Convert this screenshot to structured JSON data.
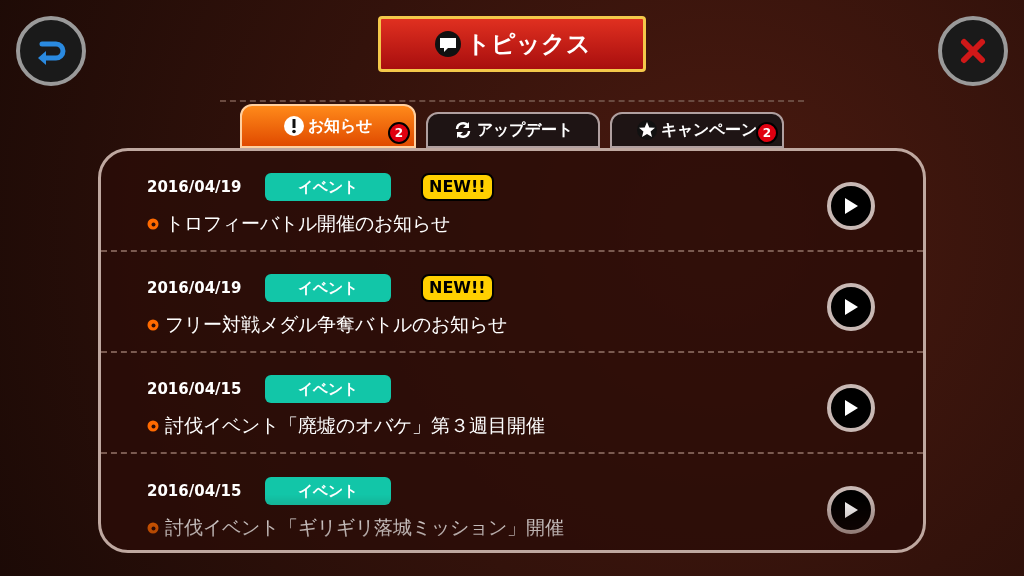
{
  "header": {
    "title": "トピックス"
  },
  "tabs": [
    {
      "label": "お知らせ",
      "kind": "notice",
      "selected": true,
      "badge": "2"
    },
    {
      "label": "アップデート",
      "kind": "update",
      "selected": false
    },
    {
      "label": "キャンペーン",
      "kind": "campaign",
      "selected": false,
      "badge": "2"
    }
  ],
  "topics": [
    {
      "date": "2016/04/19",
      "tag": "イベント",
      "new": true,
      "new_label": "NEW!!",
      "title": "トロフィーバトル開催のお知らせ"
    },
    {
      "date": "2016/04/19",
      "tag": "イベント",
      "new": true,
      "new_label": "NEW!!",
      "title": "フリー対戦メダル争奪バトルのお知らせ"
    },
    {
      "date": "2016/04/15",
      "tag": "イベント",
      "new": false,
      "title": "討伐イベント「廃墟のオバケ」第３週目開催"
    },
    {
      "date": "2016/04/15",
      "tag": "イベント",
      "new": false,
      "title": "討伐イベント「ギリギリ落城ミッション」開催"
    }
  ]
}
